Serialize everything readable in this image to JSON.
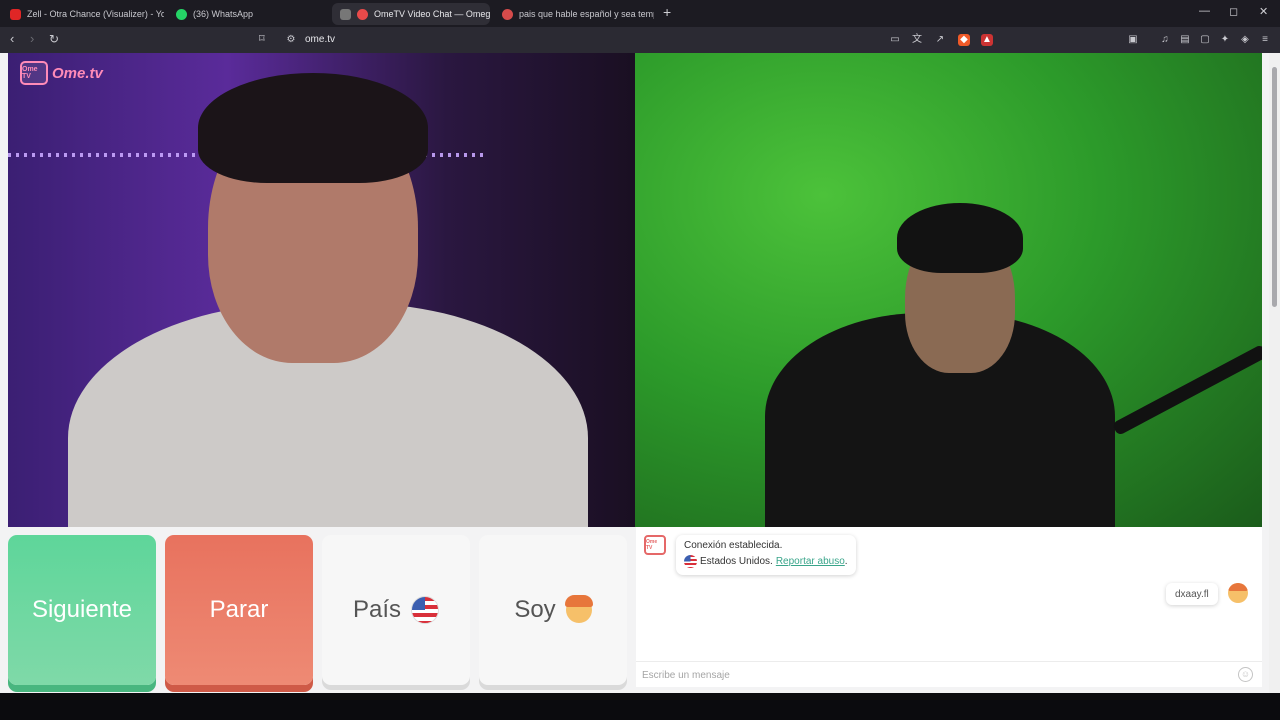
{
  "browser": {
    "tabs": [
      {
        "label": "Zell - Otra Chance (Visualizer) - YouT",
        "favicon_color": "#e02626"
      },
      {
        "label": "(36) WhatsApp",
        "favicon_color": "#25d366"
      },
      {
        "label": "OmeTV Video Chat — Omeg",
        "favicon_color": "#e84a4a",
        "active": true
      },
      {
        "label": "pais que hable español y sea tempra",
        "favicon_color": "#d64b4b"
      }
    ],
    "address": "ome.tv",
    "window_controls": {
      "minimize": "—",
      "maximize": "◻",
      "close": "✕"
    }
  },
  "brand": {
    "logo_text": "Ome TV",
    "name": "Ome.tv"
  },
  "controls": {
    "next_label": "Siguiente",
    "stop_label": "Parar",
    "country_label": "País",
    "me_label": "Soy"
  },
  "chat": {
    "system_message": {
      "line1": "Conexión establecida.",
      "country": "Estados Unidos.",
      "report_link": "Reportar abuso",
      "report_suffix": "."
    },
    "my_message": "dxaay.fl",
    "input_placeholder": "Escribe un mensaje",
    "input_value": ""
  },
  "colors": {
    "next_button": "#6fd6a0",
    "stop_button": "#ea7b66",
    "link": "#39a58a",
    "brand_pink": "#ff8bb8"
  }
}
